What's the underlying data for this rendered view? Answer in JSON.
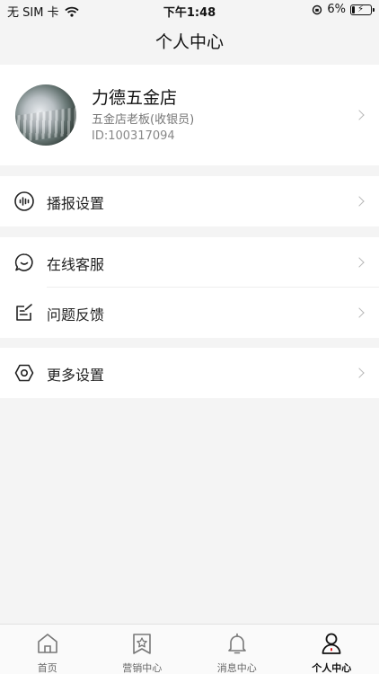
{
  "status_bar": {
    "carrier": "无 SIM 卡",
    "time": "下午1:48",
    "battery": "6%"
  },
  "header": {
    "title": "个人中心"
  },
  "profile": {
    "name": "力德五金店",
    "role": "五金店老板(收银员)",
    "id": "ID:100317094"
  },
  "menu": {
    "broadcast": {
      "label": "播报设置",
      "icon": "sound-wave-icon"
    },
    "online_service": {
      "label": "在线客服",
      "icon": "chat-icon"
    },
    "feedback": {
      "label": "问题反馈",
      "icon": "edit-note-icon"
    },
    "more_settings": {
      "label": "更多设置",
      "icon": "hexagon-settings-icon"
    }
  },
  "tabs": [
    {
      "label": "首页",
      "icon": "home-icon",
      "active": false
    },
    {
      "label": "营销中心",
      "icon": "marketing-star-icon",
      "active": false
    },
    {
      "label": "消息中心",
      "icon": "bell-icon",
      "active": false
    },
    {
      "label": "个人中心",
      "icon": "person-icon",
      "active": true
    }
  ],
  "colors": {
    "background": "#f4f4f4",
    "card": "#ffffff",
    "accent_red": "#e02020"
  }
}
